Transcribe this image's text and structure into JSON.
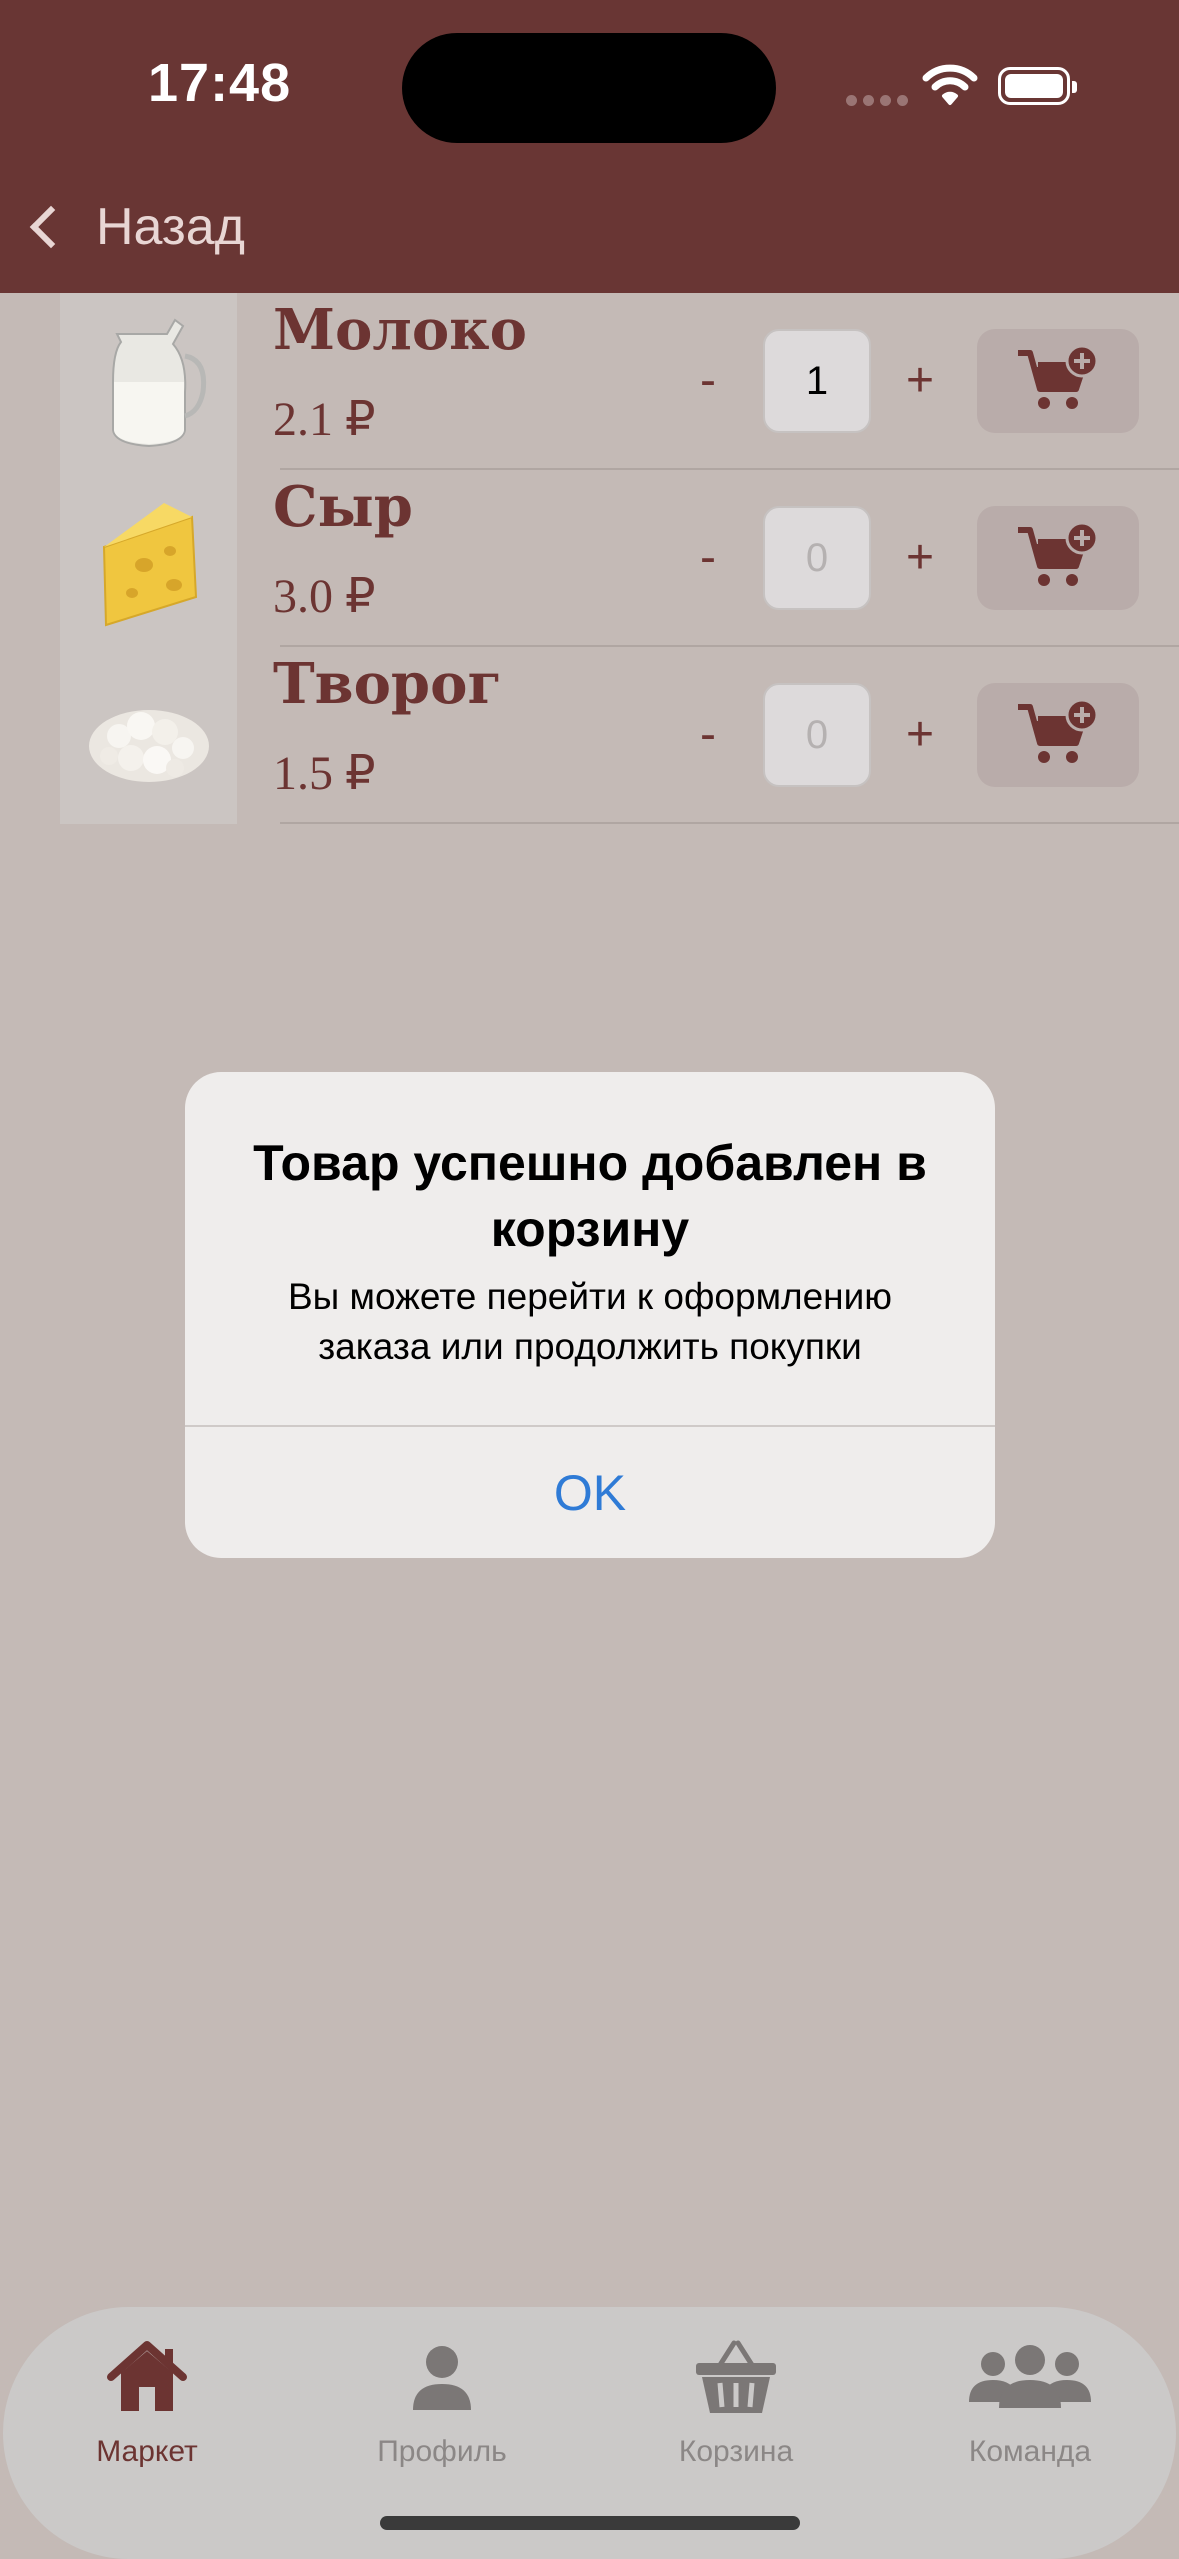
{
  "status_bar": {
    "time": "17:48"
  },
  "nav": {
    "back_label": "Назад"
  },
  "products": [
    {
      "name": "Молоко",
      "price": "2.1 ₽",
      "quantity": "1",
      "image": "milk-jug"
    },
    {
      "name": "Сыр",
      "price": "3.0 ₽",
      "quantity": "0",
      "image": "cheese"
    },
    {
      "name": "Творог",
      "price": "1.5 ₽",
      "quantity": "0",
      "image": "cottage-cheese"
    }
  ],
  "controls": {
    "minus": "-",
    "plus": "+"
  },
  "alert": {
    "title": "Товар успешно добавлен в корзину",
    "message": "Вы можете перейти к оформлению заказа или продолжить покупки",
    "ok": "OK"
  },
  "tabbar": {
    "items": [
      {
        "label": "Маркет",
        "icon": "home-icon",
        "active": true
      },
      {
        "label": "Профиль",
        "icon": "person-icon",
        "active": false
      },
      {
        "label": "Корзина",
        "icon": "basket-icon",
        "active": false
      },
      {
        "label": "Команда",
        "icon": "team-icon",
        "active": false
      }
    ]
  },
  "colors": {
    "brand": "#693634",
    "accent_text": "#6c3432",
    "link": "#2f7bd6",
    "tab_inactive": "#7b7776"
  }
}
